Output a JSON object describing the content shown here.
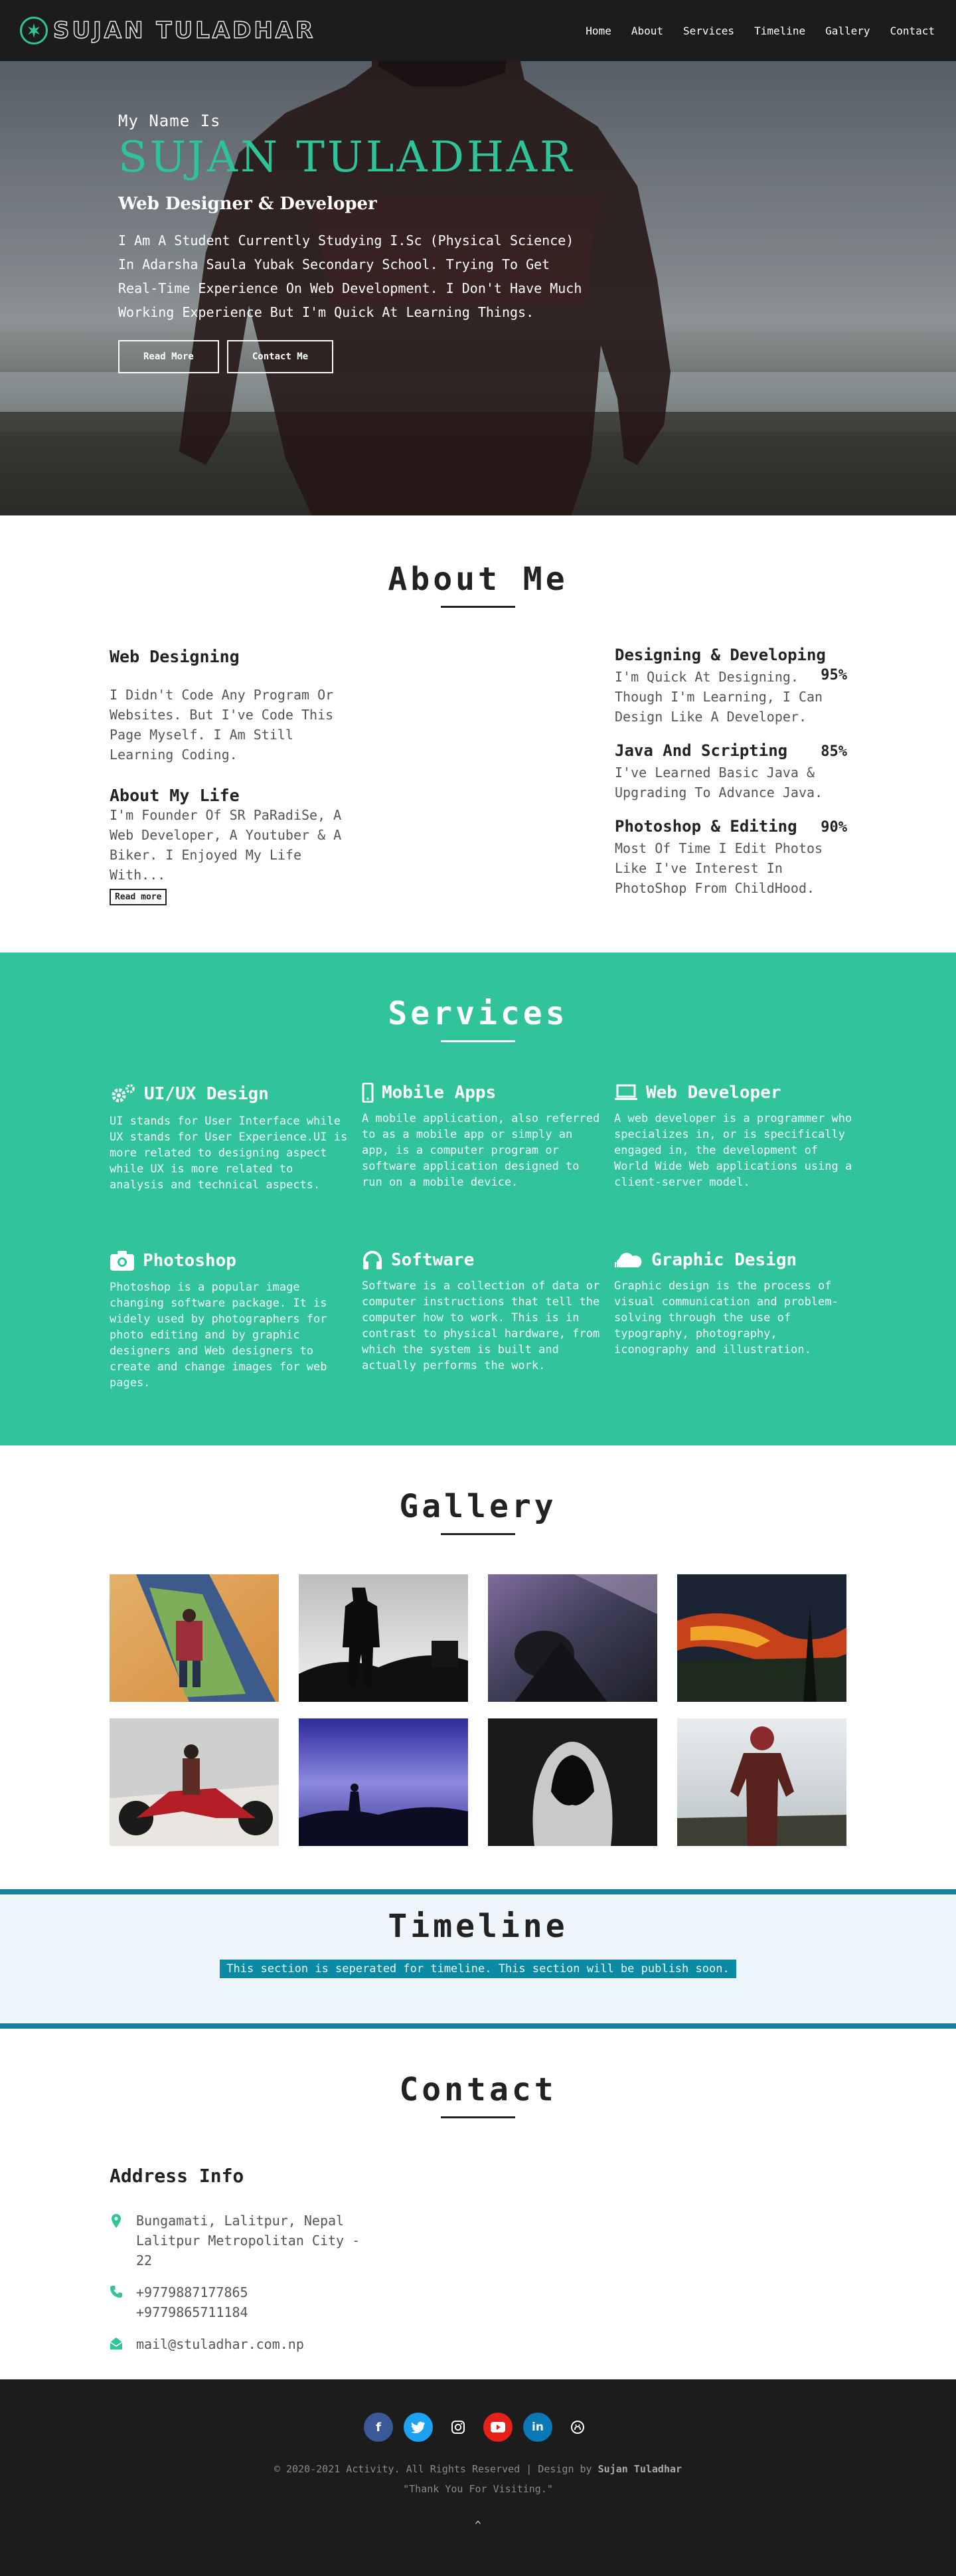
{
  "nav": {
    "brand": "SUJAN TULADHAR",
    "brand_icon": "jedi-order-icon",
    "links": [
      "Home",
      "About",
      "Services",
      "Timeline",
      "Gallery",
      "Contact"
    ]
  },
  "hero": {
    "intro": "My Name Is",
    "name": "SUJAN TULADHAR",
    "role": "Web Designer & Developer",
    "description": "I Am A Student Currently Studying I.Sc (Physical Science) In Adarsha Saula Yubak Secondary School. Trying To Get Real-Time Experience On Web Development. I Don't Have Much Working Experience But I'm Quick At Learning Things.",
    "read_more": "Read More",
    "contact_me": "Contact Me"
  },
  "about": {
    "title": "About Me",
    "web_title": "Web Designing",
    "web_text": "I Didn't Code Any Program Or Websites. But I've Code This Page Myself. I Am Still Learning Coding.",
    "life_title": "About My Life",
    "life_text": "I'm Founder Of SR PaRadiSe, A Web Developer, A Youtuber & A Biker. I Enjoyed My Life With...",
    "read_more": "Read more",
    "skills": [
      {
        "name": "Designing & Developing",
        "percent": "95%",
        "desc": "I'm Quick At Designing. Though I'm Learning, I Can Design Like A Developer."
      },
      {
        "name": "Java And Scripting",
        "percent": "85%",
        "desc": "I've Learned Basic Java & Upgrading To Advance Java."
      },
      {
        "name": "Photoshop & Editing",
        "percent": "90%",
        "desc": "Most Of Time I Edit Photos Like I've Interest In PhotoShop From ChildHood."
      }
    ]
  },
  "services": {
    "title": "Services",
    "items": [
      {
        "icon": "gears-icon",
        "title": "UI/UX Design",
        "desc": "UI stands for User Interface while UX stands for User Experience.UI is more related to designing aspect while UX is more related to analysis and technical aspects."
      },
      {
        "icon": "mobile-icon",
        "title": "Mobile Apps",
        "desc": "A mobile application, also referred to as a mobile app or simply an app, is a computer program or software application designed to run on a mobile device."
      },
      {
        "icon": "laptop-icon",
        "title": "Web Developer",
        "desc": "A web developer is a programmer who specializes in, or is specifically engaged in, the development of World Wide Web applications using a client-server model."
      },
      {
        "icon": "camera-icon",
        "title": "Photoshop",
        "desc": "Photoshop is a popular image changing software package. It is widely used by photographers for photo editing and by graphic designers and Web designers to create and change images for web pages."
      },
      {
        "icon": "headphones-icon",
        "title": "Software",
        "desc": "Software is a collection of data or computer instructions that tell the computer how to work. This is in contrast to physical hardware, from which the system is built and actually performs the work."
      },
      {
        "icon": "cloud-icon",
        "title": "Graphic Design",
        "desc": "Graphic design is the process of visual communication and problem-solving through the use of typography, photography, iconography and illustration."
      }
    ]
  },
  "gallery": {
    "title": "Gallery"
  },
  "timeline": {
    "title": "Timeline",
    "note": "This section is seperated for timeline. This section will be publish soon."
  },
  "contact": {
    "title": "Contact",
    "address_title": "Address Info",
    "address": [
      "Bungamati, Lalitpur, Nepal",
      "Lalitpur Metropolitan City -",
      "22"
    ],
    "phones": [
      "+9779887177865",
      "+9779865711184"
    ],
    "email": "mail@stuladhar.com.np"
  },
  "footer": {
    "socials": [
      "facebook-icon",
      "twitter-icon",
      "instagram-icon",
      "youtube-icon",
      "linkedin-icon",
      "github-icon"
    ],
    "copyright_prefix": "© 2020-2021 Activity. All Rights Reserved | Design by",
    "designer": "Sujan Tuladhar",
    "thanks": "\"Thank You For Visiting.\"",
    "up": "^"
  },
  "colors": {
    "accent": "#31c39a",
    "dark": "#1c1c1c",
    "timeline_border": "#18809a"
  }
}
